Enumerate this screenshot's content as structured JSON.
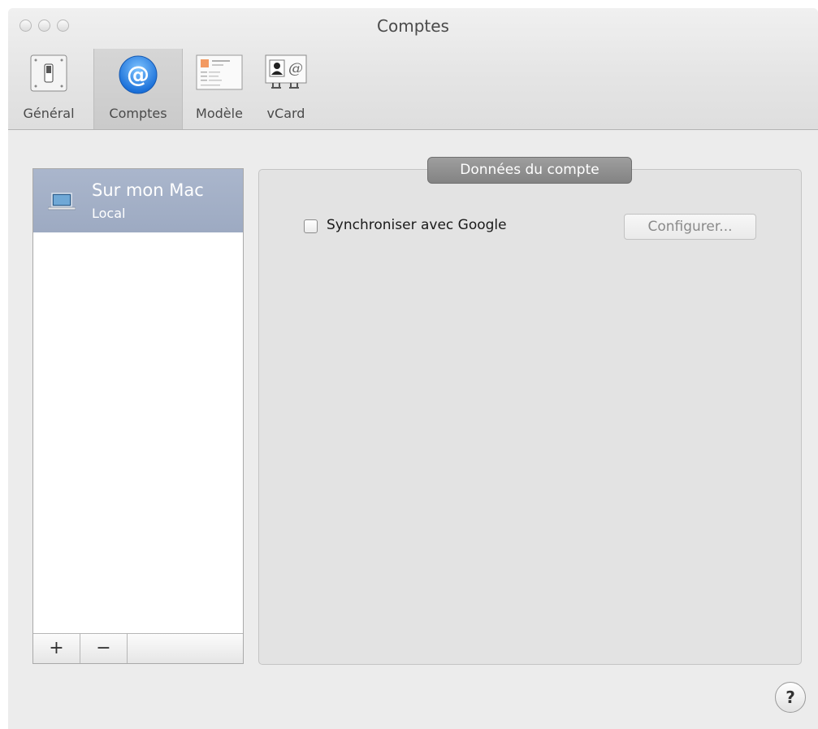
{
  "window": {
    "title": "Comptes"
  },
  "toolbar": {
    "items": [
      {
        "label": "Général",
        "icon": "general-switch-icon"
      },
      {
        "label": "Comptes",
        "icon": "at-sign-icon",
        "selected": true
      },
      {
        "label": "Modèle",
        "icon": "template-card-icon"
      },
      {
        "label": "vCard",
        "icon": "vcard-icon"
      }
    ]
  },
  "accounts": {
    "items": [
      {
        "name": "Sur mon Mac",
        "subtitle": "Local",
        "icon": "laptop-icon",
        "selected": true
      }
    ],
    "add_label": "+",
    "remove_label": "−"
  },
  "details": {
    "group_title": "Données du compte",
    "sync_label": "Synchroniser avec Google",
    "sync_checked": false,
    "configure_label": "Configurer..."
  },
  "help": {
    "label": "?"
  },
  "colors": {
    "selection": "#a3b0c7",
    "accent_blue": "#2f8ff0"
  }
}
